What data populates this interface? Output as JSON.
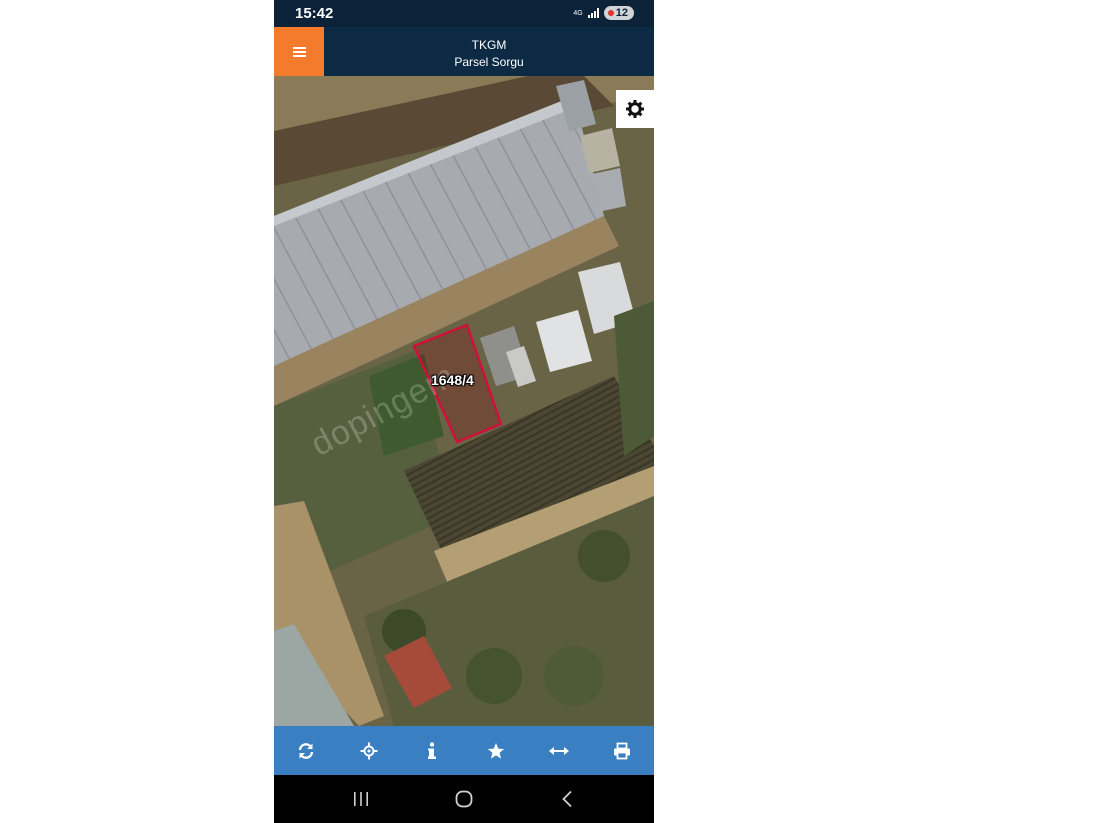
{
  "status_bar": {
    "time": "15:42",
    "network": "4G",
    "battery": "12"
  },
  "header": {
    "title": "TKGM",
    "subtitle": "Parsel Sorgu"
  },
  "map": {
    "parcel_label": "1648/4",
    "watermark": "dopingem",
    "parcel_outline_color": "#d0103a"
  },
  "toolbar": {
    "buttons": [
      {
        "icon": "refresh-icon"
      },
      {
        "icon": "crosshair-icon"
      },
      {
        "icon": "info-icon"
      },
      {
        "icon": "star-icon"
      },
      {
        "icon": "measure-arrows-icon"
      },
      {
        "icon": "print-icon"
      }
    ]
  },
  "nav_bar": {
    "buttons": [
      {
        "icon": "recent-apps-icon"
      },
      {
        "icon": "home-icon"
      },
      {
        "icon": "back-icon"
      }
    ]
  },
  "colors": {
    "header_bg": "#0d2a44",
    "menu_accent": "#f47a2c",
    "toolbar_bg": "#3a7fc2"
  }
}
